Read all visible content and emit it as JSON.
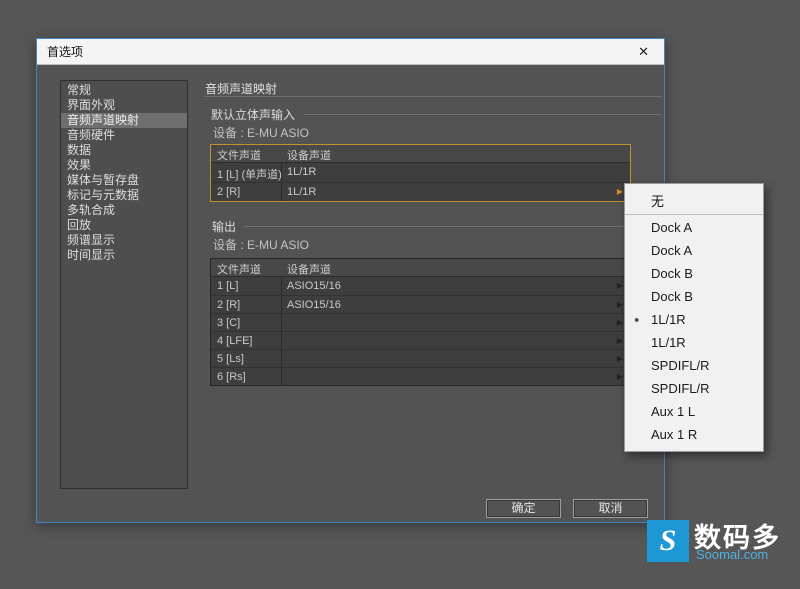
{
  "colors": {
    "dialog_border": "#3e87c6",
    "focus_orange": "#c5912e",
    "accent_blue": "#1e98d5",
    "popup_bg": "#f1f1f1"
  },
  "icons": {
    "close": "✕",
    "row_arrow": "▶",
    "radio_bullet": "●",
    "logo_s": "S"
  },
  "dialog": {
    "title": "首选项"
  },
  "sidebar": {
    "items": [
      {
        "label": "常规",
        "selected": false
      },
      {
        "label": "界面外观",
        "selected": false
      },
      {
        "label": "音频声道映射",
        "selected": true
      },
      {
        "label": "音频硬件",
        "selected": false
      },
      {
        "label": "数据",
        "selected": false
      },
      {
        "label": "效果",
        "selected": false
      },
      {
        "label": "媒体与暂存盘",
        "selected": false
      },
      {
        "label": "标记与元数据",
        "selected": false
      },
      {
        "label": "多轨合成",
        "selected": false
      },
      {
        "label": "回放",
        "selected": false
      },
      {
        "label": "频谱显示",
        "selected": false
      },
      {
        "label": "时间显示",
        "selected": false
      }
    ]
  },
  "main": {
    "title": "音频声道映射",
    "input_section": {
      "title": "默认立体声输入",
      "device_label": "设备 : E-MU ASIO",
      "table": {
        "headers": [
          "文件声道",
          "设备声道"
        ],
        "rows": [
          {
            "file": "1 [L] (单声道)",
            "device": "1L/1R",
            "active": false
          },
          {
            "file": "2 [R]",
            "device": "1L/1R",
            "active": true
          }
        ]
      }
    },
    "output_section": {
      "title": "输出",
      "device_label": "设备 : E-MU ASIO",
      "table": {
        "headers": [
          "文件声道",
          "设备声道"
        ],
        "rows": [
          {
            "file": "1 [L]",
            "device": "ASIO15/16"
          },
          {
            "file": "2 [R]",
            "device": "ASIO15/16"
          },
          {
            "file": "3 [C]",
            "device": ""
          },
          {
            "file": "4 [LFE]",
            "device": ""
          },
          {
            "file": "5 [Ls]",
            "device": ""
          },
          {
            "file": "6 [Rs]",
            "device": ""
          }
        ]
      }
    }
  },
  "popup": {
    "items": [
      {
        "label": "无",
        "selected": false
      },
      {
        "label": "Dock A",
        "selected": false
      },
      {
        "label": "Dock A",
        "selected": false
      },
      {
        "label": "Dock B",
        "selected": false
      },
      {
        "label": "Dock B",
        "selected": false
      },
      {
        "label": "1L/1R",
        "selected": true
      },
      {
        "label": "1L/1R",
        "selected": false
      },
      {
        "label": "SPDIFL/R",
        "selected": false
      },
      {
        "label": "SPDIFL/R",
        "selected": false
      },
      {
        "label": "Aux 1 L",
        "selected": false
      },
      {
        "label": "Aux 1 R",
        "selected": false
      }
    ]
  },
  "footer": {
    "ok": "确定",
    "cancel": "取消"
  },
  "watermark": {
    "brand": "数码多",
    "site": "Soomal.com"
  }
}
